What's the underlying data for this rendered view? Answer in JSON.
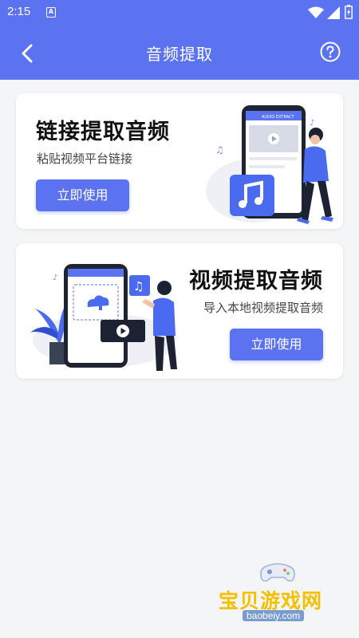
{
  "status_bar": {
    "time": "2:15",
    "notification_letter": "A"
  },
  "app_bar": {
    "title": "音频提取"
  },
  "cards": [
    {
      "title": "链接提取音频",
      "subtitle": "粘贴视频平台链接",
      "button": "立即使用"
    },
    {
      "title": "视频提取音频",
      "subtitle": "导入本地视频提取音频",
      "button": "立即使用"
    }
  ],
  "illustration": {
    "phone_header": "AUDIO EXTRACT"
  },
  "watermark": {
    "text": "宝贝游戏网",
    "domain": "baobeiy.com"
  },
  "colors": {
    "primary": "#5b73f0",
    "background": "#f4f5f7"
  },
  "icons": [
    "back-icon",
    "help-icon",
    "wifi-icon",
    "signal-icon",
    "battery-icon",
    "music-note-icon",
    "play-icon"
  ]
}
